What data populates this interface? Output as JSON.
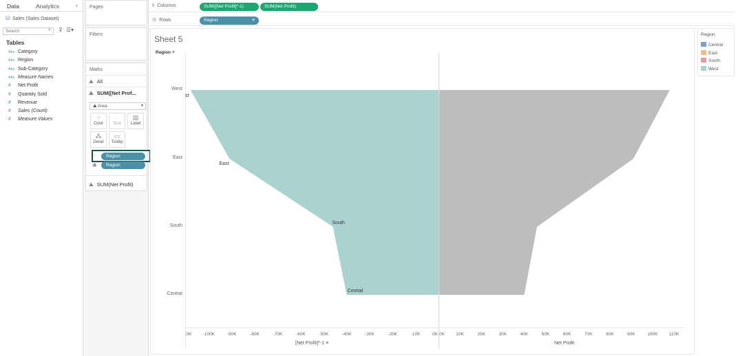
{
  "data_pane": {
    "tabs": [
      "Data",
      "Analytics"
    ],
    "datasource": "Sales (Sales Dataset)",
    "search_placeholder": "Search",
    "tables_heading": "Tables",
    "fields": [
      {
        "type": "Abc",
        "name": "Category",
        "italic": false,
        "measure": false
      },
      {
        "type": "Abc",
        "name": "Region",
        "italic": false,
        "measure": false
      },
      {
        "type": "Abc",
        "name": "Sub-Category",
        "italic": false,
        "measure": false
      },
      {
        "type": "Abc",
        "name": "Measure Names",
        "italic": true,
        "measure": false
      },
      {
        "type": "#",
        "name": "Net Profit",
        "italic": false,
        "measure": true
      },
      {
        "type": "#",
        "name": "Quantity Sold",
        "italic": false,
        "measure": true
      },
      {
        "type": "#",
        "name": "Revenue",
        "italic": false,
        "measure": true
      },
      {
        "type": "#",
        "name": "Sales (Count)",
        "italic": true,
        "measure": true
      },
      {
        "type": "#",
        "name": "Measure Values",
        "italic": true,
        "measure": true
      }
    ]
  },
  "cards": {
    "pages_title": "Pages",
    "filters_title": "Filters",
    "marks_title": "Marks",
    "marks_all": "All",
    "marks_measure1": "SUM([Net Prof...",
    "mark_type": "Area",
    "props": [
      "Color",
      "Size",
      "Label",
      "Detail",
      "Tooltip"
    ],
    "color_pill": "Region",
    "detail_pill": "Region",
    "marks_measure2": "SUM(Net Profit)"
  },
  "shelves": {
    "columns_label": "Columns",
    "columns_pills": [
      "SUM([Net Profit]*-1)",
      "SUM(Net Profit)"
    ],
    "rows_label": "Rows",
    "rows_pill": "Region"
  },
  "view": {
    "sheet_title": "Sheet 5",
    "row_header": "Region"
  },
  "legend": {
    "title": "Region",
    "items": [
      {
        "name": "Central",
        "color": "#7b9fc6"
      },
      {
        "name": "East",
        "color": "#f2bd84"
      },
      {
        "name": "South",
        "color": "#e89a9a"
      },
      {
        "name": "West",
        "color": "#aad2ce"
      }
    ]
  },
  "chart_data": [
    {
      "type": "area",
      "title": "",
      "xlabel": "[Net Profit]*-1",
      "ylabel": "Region",
      "categories": [
        "West",
        "East",
        "South",
        "Central"
      ],
      "series": [
        {
          "name": "West",
          "values": [
            -108000,
            -91000,
            -46000,
            -40000
          ]
        }
      ],
      "mark_labels": [
        "West",
        "East",
        "South",
        "Central"
      ],
      "xlim": [
        -110000,
        0
      ],
      "x_tick_values": [
        -110000,
        -100000,
        -90000,
        -80000,
        -70000,
        -60000,
        -50000,
        -40000,
        -30000,
        -20000,
        -10000,
        0
      ],
      "x_tick_labels": [
        "-110K",
        "-100K",
        "-90K",
        "-80K",
        "-70K",
        "-60K",
        "-50K",
        "-40K",
        "-30K",
        "-20K",
        "-10K",
        "0K"
      ],
      "color": "#aad2ce"
    },
    {
      "type": "area",
      "title": "",
      "xlabel": "Net Profit",
      "ylabel": "Region",
      "categories": [
        "West",
        "East",
        "South",
        "Central"
      ],
      "values": [
        108000,
        91000,
        46000,
        40000
      ],
      "xlim": [
        0,
        110000
      ],
      "x_tick_values": [
        0,
        10000,
        20000,
        30000,
        40000,
        50000,
        60000,
        70000,
        80000,
        90000,
        100000,
        110000
      ],
      "x_tick_labels": [
        "0K",
        "10K",
        "20K",
        "30K",
        "40K",
        "50K",
        "60K",
        "70K",
        "80K",
        "90K",
        "100K",
        "110K"
      ],
      "color": "#bdbdbd"
    }
  ]
}
